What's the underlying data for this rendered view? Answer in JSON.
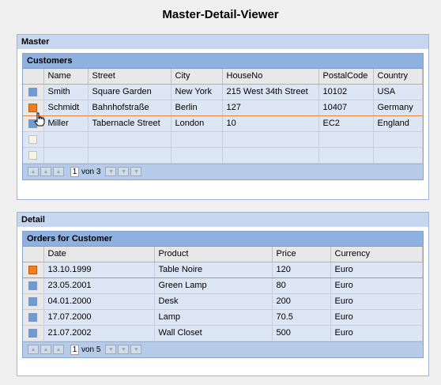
{
  "title": "Master-Detail-Viewer",
  "master": {
    "label": "Master",
    "tray_title": "Customers",
    "columns": [
      "Name",
      "Street",
      "City",
      "HouseNo",
      "PostalCode",
      "Country"
    ],
    "rows": [
      [
        "Smith",
        "Square Garden",
        "New York",
        "215 West 34th Street",
        "10102",
        "USA"
      ],
      [
        "Schmidt",
        "Bahnhofstraße",
        "Berlin",
        "127",
        "10407",
        "Germany"
      ],
      [
        "Miller",
        "Tabernacle Street",
        "London",
        "10",
        "EC2",
        "England"
      ],
      [
        "",
        "",
        "",
        "",
        "",
        ""
      ],
      [
        "",
        "",
        "",
        "",
        "",
        ""
      ]
    ],
    "selected_row": 1,
    "pager": {
      "page": "1",
      "of_text": "von 3"
    }
  },
  "detail": {
    "label": "Detail",
    "tray_title": "Orders for Customer",
    "columns": [
      "Date",
      "Product",
      "Price",
      "Currency"
    ],
    "rows": [
      [
        "13.10.1999",
        "Table Noire",
        "120",
        "Euro"
      ],
      [
        "23.05.2001",
        "Green Lamp",
        "80",
        "Euro"
      ],
      [
        "04.01.2000",
        "Desk",
        "200",
        "Euro"
      ],
      [
        "17.07.2000",
        "Lamp",
        "70.5",
        "Euro"
      ],
      [
        "21.07.2002",
        "Wall Closet",
        "500",
        "Euro"
      ]
    ],
    "selected_row": 0,
    "pager": {
      "page": "1",
      "of_text": "von 5"
    }
  },
  "colors": {
    "selected": "#f07d1f",
    "tray_header": "#8eb1df",
    "row": "#dde6f5"
  }
}
